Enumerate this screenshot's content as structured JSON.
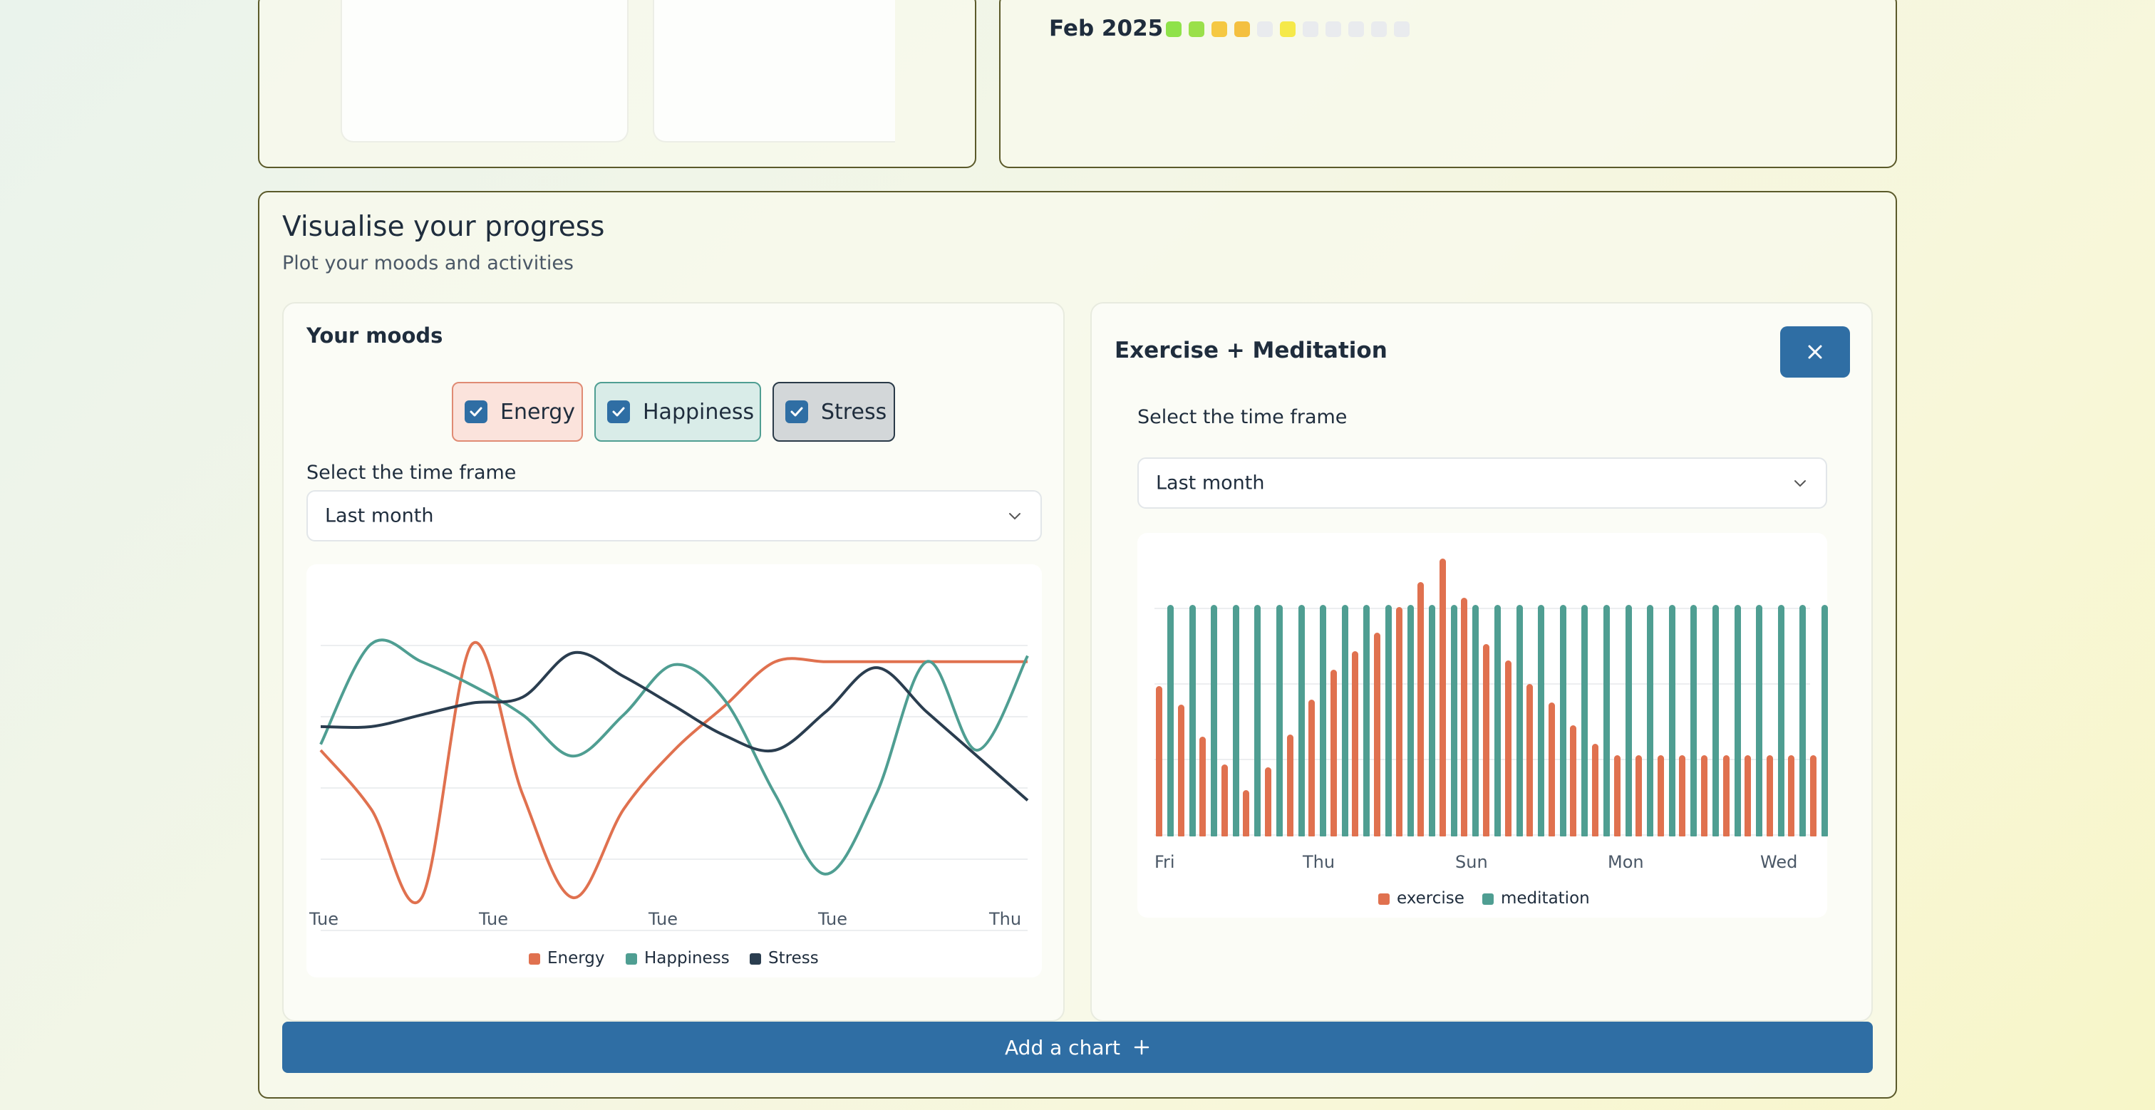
{
  "streak": {
    "month_label": "Feb 2025",
    "day_colors": [
      "#8fe24a",
      "#9ae04a",
      "#f5c842",
      "#f4c040",
      "#e9ebee",
      "#f5e94a",
      "#e9ebee",
      "#e9ebee",
      "#e9ebee",
      "#e9ebee",
      "#e9ebee"
    ]
  },
  "progress": {
    "title": "Visualise your progress",
    "subtitle": "Plot your moods and activities",
    "add_chart_label": "Add a chart",
    "add_icon": "plus-icon"
  },
  "moods_card": {
    "title": "Your moods",
    "toggles": [
      {
        "label": "Energy",
        "checked": true,
        "bg": "#fbe3dc",
        "border": "#e08b74"
      },
      {
        "label": "Happiness",
        "checked": true,
        "bg": "#d9ece8",
        "border": "#4f9e92"
      },
      {
        "label": "Stress",
        "checked": true,
        "bg": "#d3d7d9",
        "border": "#2a3a48"
      }
    ],
    "timeframe_label": "Select the time frame",
    "timeframe_value": "Last month"
  },
  "activity_card": {
    "title": "Exercise + Meditation",
    "close_icon": "close-icon",
    "timeframe_label": "Select the time frame",
    "timeframe_value": "Last month"
  },
  "chart_data": [
    {
      "type": "line",
      "x_ticks": [
        "Tue",
        "Tue",
        "Tue",
        "Tue",
        "Thu"
      ],
      "ylim": [
        0,
        10
      ],
      "grid": true,
      "legend_position": "bottom",
      "series": [
        {
          "name": "Energy",
          "color": "#e0714f",
          "values": [
            5.0,
            3.0,
            0.0,
            8.6,
            3.5,
            0.0,
            3.0,
            5.0,
            6.5,
            8.0,
            8.0,
            8.0,
            8.0,
            8.0,
            8.0
          ]
        },
        {
          "name": "Happiness",
          "color": "#4f9e92",
          "values": [
            5.2,
            8.6,
            8.0,
            7.2,
            6.2,
            4.8,
            6.2,
            7.9,
            6.7,
            3.5,
            0.8,
            3.5,
            8.0,
            5.0,
            8.2
          ]
        },
        {
          "name": "Stress",
          "color": "#2a3d4f",
          "values": [
            5.8,
            5.8,
            6.2,
            6.6,
            6.8,
            8.3,
            7.5,
            6.5,
            5.5,
            5.0,
            6.3,
            7.8,
            6.3,
            4.8,
            3.3
          ]
        }
      ]
    },
    {
      "type": "bar",
      "x_ticks": [
        "Fri",
        "Thu",
        "Sun",
        "Mon",
        "Wed"
      ],
      "ylim": [
        0,
        12
      ],
      "grid": true,
      "legend_position": "bottom",
      "series": [
        {
          "name": "exercise",
          "color": "#e0714f",
          "values": [
            6.5,
            5.7,
            4.3,
            3.1,
            2.0,
            3.0,
            4.4,
            5.9,
            7.2,
            8.0,
            8.8,
            9.9,
            11.0,
            12.0,
            10.3,
            8.3,
            7.6,
            6.6,
            5.8,
            4.8,
            4.0,
            3.5,
            3.5,
            3.5,
            3.5,
            3.5,
            3.5,
            3.5,
            3.5,
            3.5,
            3.5
          ]
        },
        {
          "name": "meditation",
          "color": "#4f9e92",
          "values": [
            10,
            10,
            10,
            10,
            10,
            10,
            10,
            10,
            10,
            10,
            10,
            10,
            10,
            10,
            10,
            10,
            10,
            10,
            10,
            10,
            10,
            10,
            10,
            10,
            10,
            10,
            10,
            10,
            10,
            10,
            10
          ]
        }
      ]
    }
  ]
}
